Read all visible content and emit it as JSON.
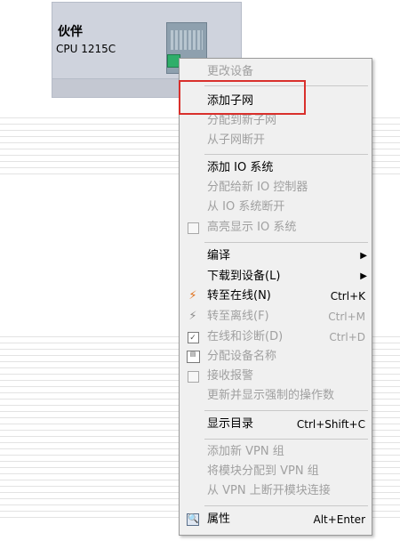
{
  "device": {
    "name": "伙伴",
    "cpu": "CPU 1215C"
  },
  "menu": {
    "items": [
      {
        "label": "更改设备",
        "disabled": true
      },
      {
        "label": "添加子网",
        "disabled": false
      },
      {
        "label": "分配到新子网",
        "disabled": true
      },
      {
        "label": "从子网断开",
        "disabled": true
      },
      {
        "label": "添加 IO 系统",
        "disabled": false
      },
      {
        "label": "分配给新 IO 控制器",
        "disabled": true
      },
      {
        "label": "从 IO 系统断开",
        "disabled": true
      },
      {
        "label": "高亮显示 IO 系统",
        "disabled": true
      },
      {
        "label": "编译",
        "disabled": false
      },
      {
        "label": "下载到设备(L)",
        "disabled": false
      },
      {
        "label": "转至在线(N)",
        "shortcut": "Ctrl+K",
        "disabled": false
      },
      {
        "label": "转至离线(F)",
        "shortcut": "Ctrl+M",
        "disabled": true
      },
      {
        "label": "在线和诊断(D)",
        "shortcut": "Ctrl+D",
        "disabled": true
      },
      {
        "label": "分配设备名称",
        "disabled": true
      },
      {
        "label": "接收报警",
        "disabled": true
      },
      {
        "label": "更新并显示强制的操作数",
        "disabled": true
      },
      {
        "label": "显示目录",
        "shortcut": "Ctrl+Shift+C",
        "disabled": false
      },
      {
        "label": "添加新 VPN 组",
        "disabled": true
      },
      {
        "label": "将模块分配到 VPN 组",
        "disabled": true
      },
      {
        "label": "从 VPN 上断开模块连接",
        "disabled": true
      },
      {
        "label": "属性",
        "shortcut": "Alt+Enter",
        "disabled": false
      }
    ]
  },
  "icons": {
    "checkbox": "checkbox-icon",
    "go_online": "go-online-icon",
    "go_offline": "go-offline-icon",
    "diagnostics": "diagnostics-icon",
    "assign_name": "name-tag-icon",
    "properties": "properties-icon",
    "submenu": "submenu-arrow-icon"
  },
  "colors": {
    "highlight_box": "#d9302c",
    "menu_background": "#f0f0f0",
    "disabled_text": "#a0a0a0",
    "device_background": "#cfd3dd",
    "port_green": "#2fae6a"
  }
}
